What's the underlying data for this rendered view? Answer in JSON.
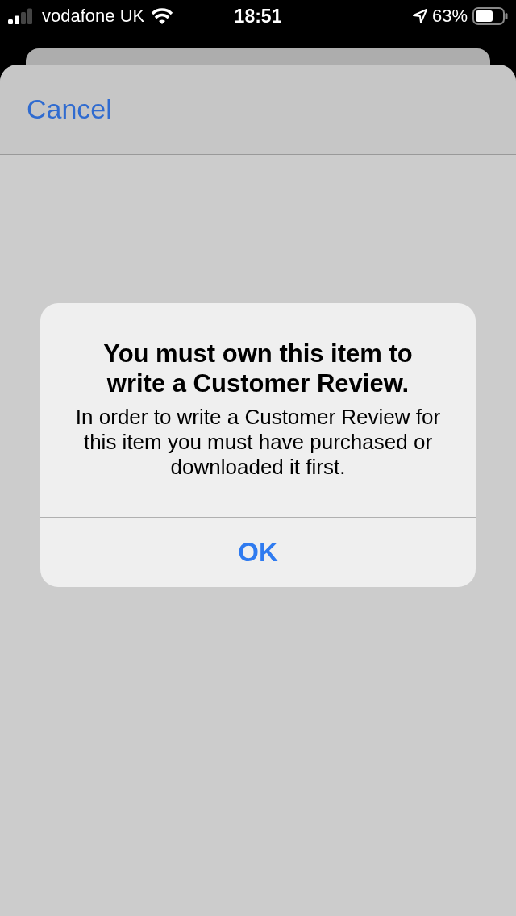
{
  "status_bar": {
    "carrier": "vodafone UK",
    "time": "18:51",
    "battery": "63%"
  },
  "sheet": {
    "cancel": "Cancel"
  },
  "alert": {
    "title": "You must own this item to write a Customer Review.",
    "message": "In order to write a Customer Review for this item you must have purchased or downloaded it first.",
    "buttons": [
      "OK"
    ]
  }
}
